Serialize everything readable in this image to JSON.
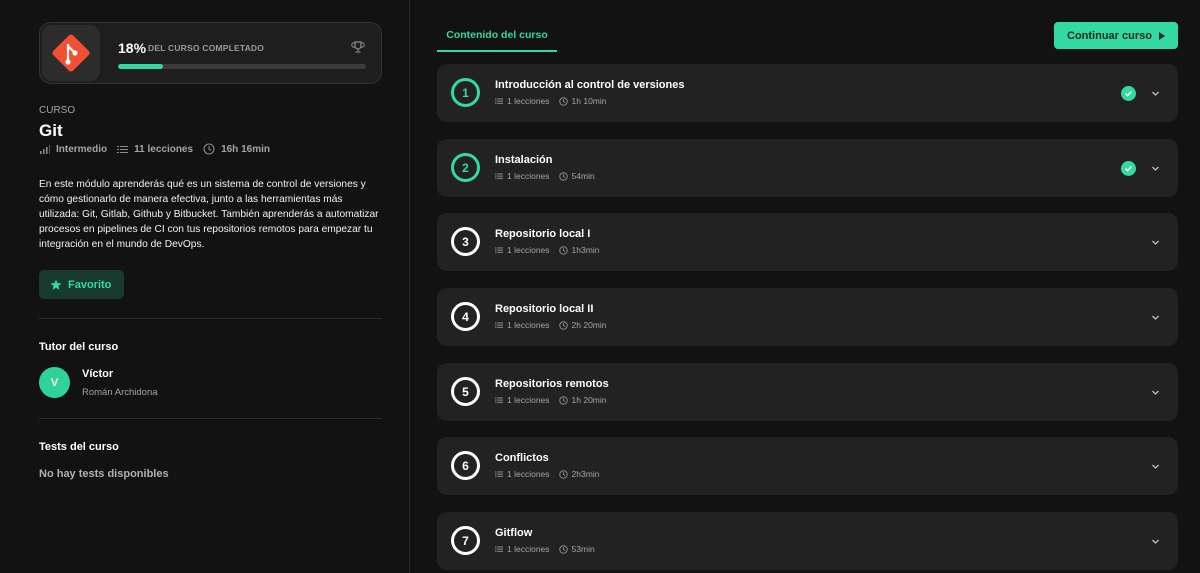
{
  "progress": {
    "percent_text": "18%",
    "label": "DEL CURSO COMPLETADO",
    "fraction": 0.18
  },
  "course": {
    "section_label": "CURSO",
    "title": "Git",
    "level": "Intermedio",
    "lessons": "11 lecciones",
    "duration": "16h 16min",
    "description": "En este módulo aprenderás qué es un sistema de control de versiones y cómo gestionarlo de manera efectiva, junto a las herramientas más utilizada: Git, Gitlab, Github y Bitbucket. También aprenderás a automatizar procesos en pipelines de CI con tus repositorios remotos para empezar tu integración en el mundo de DevOps.",
    "favorite_label": "Favorito"
  },
  "tutor": {
    "heading": "Tutor del curso",
    "initial": "V",
    "name": "Víctor",
    "surname": "Román Archidona"
  },
  "tests": {
    "heading": "Tests del curso",
    "empty": "No hay tests disponibles"
  },
  "content": {
    "tab_label": "Contenido del curso",
    "continue_label": "Continuar curso",
    "modules": [
      {
        "number": "1",
        "title": "Introducción al control de versiones",
        "lessons": "1 lecciones",
        "duration": "1h 10min",
        "completed": true
      },
      {
        "number": "2",
        "title": "Instalación",
        "lessons": "1 lecciones",
        "duration": "54min",
        "completed": true
      },
      {
        "number": "3",
        "title": "Repositorio local I",
        "lessons": "1 lecciones",
        "duration": "1h3min",
        "completed": false
      },
      {
        "number": "4",
        "title": "Repositorio local II",
        "lessons": "1 lecciones",
        "duration": "2h 20min",
        "completed": false
      },
      {
        "number": "5",
        "title": "Repositorios remotos",
        "lessons": "1 lecciones",
        "duration": "1h 20min",
        "completed": false
      },
      {
        "number": "6",
        "title": "Conflictos",
        "lessons": "1 lecciones",
        "duration": "2h3min",
        "completed": false
      },
      {
        "number": "7",
        "title": "Gitflow",
        "lessons": "1 lecciones",
        "duration": "53min",
        "completed": false
      }
    ]
  },
  "colors": {
    "accent": "#34d8a3",
    "background": "#121212",
    "card": "#222222",
    "git_logo": "#f05033"
  }
}
